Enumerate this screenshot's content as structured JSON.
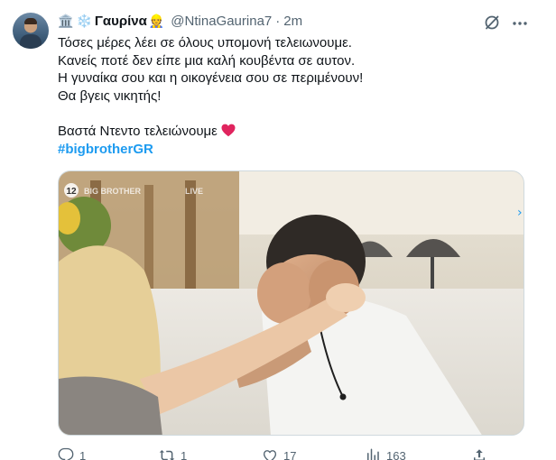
{
  "tweet": {
    "display_name": "Γαυρίνα",
    "name_emojis": [
      "🏛️",
      "❄️"
    ],
    "name_suffix_emoji": "👷",
    "handle": "@NtinaGaurina7",
    "separator": "·",
    "time": "2m",
    "lines": [
      "Τόσες μέρες λέει σε όλους υπομονή τελειωνουμε.",
      "Κανείς ποτέ δεν είπε μια καλή κουβέντα σε αυτον.",
      "Η γυναίκα σου και η οικογένεια σου σε περιμένουν!",
      "Θα βγεις νικητής!"
    ],
    "closing_line": "Βαστά Ντεντο τελειώνουμε",
    "hashtag": "#bigbrotherGR"
  },
  "media": {
    "watermark_channel": "12",
    "watermark_text": "BIG BROTHER",
    "watermark_live": "LIVE"
  },
  "actions": {
    "replies": "1",
    "retweets": "1",
    "likes": "17",
    "views": "163"
  },
  "colors": {
    "text": "#0f1419",
    "secondary": "#536471",
    "link": "#1d9bf0",
    "heart": "#e0245e",
    "border": "#cfd9de"
  }
}
